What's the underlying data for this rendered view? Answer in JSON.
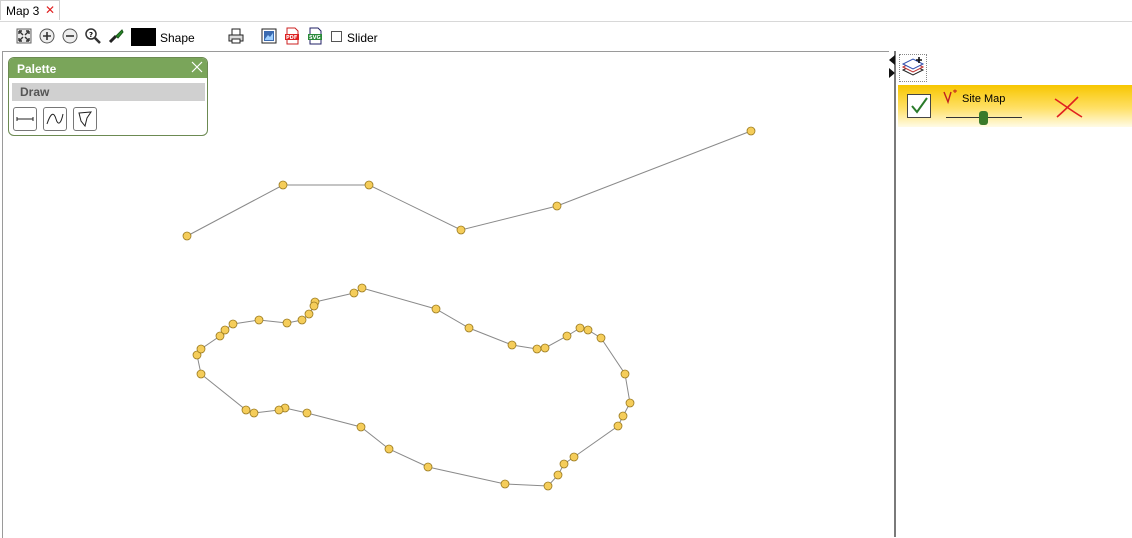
{
  "tab": {
    "label": "Map 3",
    "close_glyph": "✕"
  },
  "toolbar": {
    "icons": [
      "zoom-extent-icon",
      "zoom-in-icon",
      "zoom-out-icon",
      "zoom-query-icon",
      "paint-brush-icon",
      "print-icon",
      "export-image-icon",
      "export-pdf-icon",
      "export-svg-icon"
    ],
    "fill_color": "#000000",
    "shape_label": "Shape",
    "slider_label": "Slider",
    "slider_checked": false
  },
  "palette": {
    "title": "Palette",
    "section": "Draw",
    "tools": [
      "line-tool-icon",
      "curve-tool-icon",
      "polygon-tool-icon"
    ],
    "header_color": "#7aa55a"
  },
  "layers": {
    "items": [
      {
        "name": "Site Map",
        "visible": true,
        "opacity": 0.45
      }
    ],
    "row_color": "#f7c600"
  },
  "map": {
    "line_color": "#8a8a8a",
    "vertex_color": "#f5cd5a"
  }
}
